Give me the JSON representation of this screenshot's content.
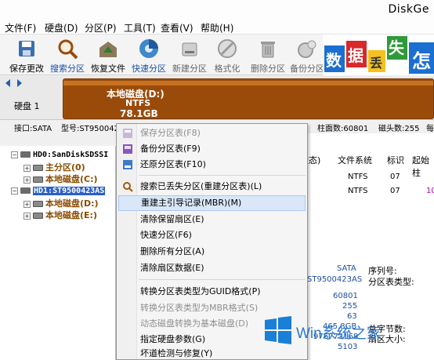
{
  "app": {
    "title": "DiskGe"
  },
  "menu": [
    "文件(F)",
    "硬盘(D)",
    "分区(P)",
    "工具(T)",
    "查看(V)",
    "帮助(H)"
  ],
  "toolbar": [
    {
      "label": "保存更改",
      "icon": "save-icon",
      "style": "normal"
    },
    {
      "label": "搜索分区",
      "icon": "search-icon",
      "style": "blue"
    },
    {
      "label": "恢复文件",
      "icon": "recover-icon",
      "style": "normal"
    },
    {
      "label": "快速分区",
      "icon": "quick-partition-icon",
      "style": "blue"
    },
    {
      "label": "新建分区",
      "icon": "new-partition-icon",
      "style": "normal"
    },
    {
      "label": "格式化",
      "icon": "format-icon",
      "style": "normal"
    },
    {
      "label": "删除分区",
      "icon": "delete-icon",
      "style": "normal"
    },
    {
      "label": "备份分区",
      "icon": "backup-icon",
      "style": "normal"
    }
  ],
  "banner": {
    "chars": [
      "数",
      "据",
      "丢",
      "失",
      "怎"
    ]
  },
  "disk_map": {
    "disk_label": "硬盘 1",
    "partition_name": "本地磁盘(D:)",
    "fs": "NTFS",
    "size": "78.1GB"
  },
  "info_line": {
    "interface": "接口:SATA",
    "model": "型号:ST9500423AS",
    "cyl_label": "柱面数:60801",
    "heads": "磁头数:255",
    "tail": "每"
  },
  "tree": {
    "nodes": [
      {
        "label": "HD0:SanDiskSDSSI",
        "kind": "disk",
        "expander": "−"
      },
      {
        "label": "主分区(0)",
        "kind": "partition",
        "expander": "+"
      },
      {
        "label": "本地磁盘(C:)",
        "kind": "partition",
        "expander": "+"
      },
      {
        "label": "HD1:ST9500423AS",
        "kind": "disk-selected",
        "expander": "−"
      },
      {
        "label": "本地磁盘(D:)",
        "kind": "partition",
        "expander": "+"
      },
      {
        "label": "本地磁盘(E:)",
        "kind": "partition",
        "expander": "+"
      }
    ]
  },
  "table": {
    "headers": [
      "状态)",
      "文件系统",
      "标识",
      "起始柱"
    ],
    "rows": [
      {
        "fs": "NTFS",
        "id": "07",
        "start": ""
      },
      {
        "fs": "NTFS",
        "id": "07",
        "start": "10"
      }
    ]
  },
  "details": {
    "iface_value": "SATA",
    "serial_label": "序列号:",
    "model_value": "ST9500423AS",
    "ptype_label": "分区表类型:",
    "cyl": "60801",
    "heads": "255",
    "sectors": "63",
    "capacity": "465.8GB",
    "total_bytes_label": "总字节数:",
    "total_sectors": "976773168",
    "sector_size_label": "扇区大小:",
    "extra": "5103"
  },
  "context_menu": [
    {
      "label": "保存分区表(F8)",
      "disabled": true,
      "icon": "save-table-icon"
    },
    {
      "label": "备份分区表(F9)",
      "disabled": false,
      "icon": "backup-table-icon"
    },
    {
      "label": "还原分区表(F10)",
      "disabled": false,
      "icon": "restore-table-icon"
    },
    {
      "sep": true
    },
    {
      "label": "搜索已丢失分区(重建分区表)(L)",
      "disabled": false,
      "icon": "search-lost-icon"
    },
    {
      "label": "重建主引导记录(MBR)(M)",
      "disabled": false,
      "selected": true
    },
    {
      "label": "清除保留扇区(E)",
      "disabled": false
    },
    {
      "label": "快速分区(F6)",
      "disabled": false
    },
    {
      "label": "删除所有分区(A)",
      "disabled": false
    },
    {
      "label": "清除扇区数据(E)",
      "disabled": false
    },
    {
      "sep": true
    },
    {
      "label": "转换分区表类型为GUID格式(P)",
      "disabled": false
    },
    {
      "label": "转换分区表类型为MBR格式(S)",
      "disabled": true
    },
    {
      "label": "动态磁盘转换为基本磁盘(D)",
      "disabled": true
    },
    {
      "label": "指定硬盘参数(G)",
      "disabled": false
    },
    {
      "label": "坏道检测与修复(Y)",
      "disabled": false
    }
  ],
  "watermark": {
    "text": "Win系统之家"
  }
}
